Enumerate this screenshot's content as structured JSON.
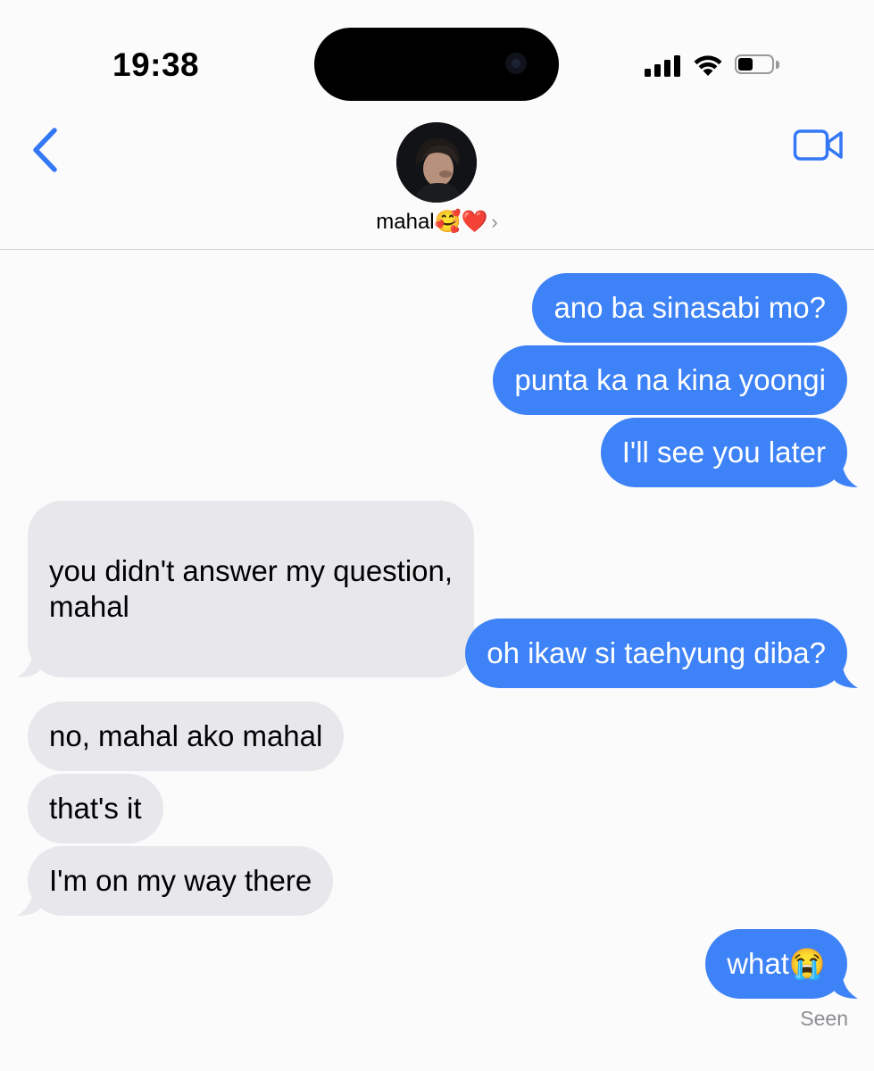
{
  "status_bar": {
    "time": "19:38",
    "battery_level": 0.45
  },
  "header": {
    "contact_name": "mahal🥰❤️",
    "chevron": "›",
    "back_icon": "chevron-left-icon",
    "video_icon": "video-camera-icon"
  },
  "colors": {
    "sent_bubble": "#3e82f7",
    "received_bubble": "#e8e8ec",
    "accent": "#3478f6",
    "background": "#fbfbfb"
  },
  "messages": [
    {
      "side": "sent",
      "text": "ano ba sinasabi mo?"
    },
    {
      "side": "sent",
      "text": "punta ka na kina yoongi"
    },
    {
      "side": "sent",
      "text": "I'll see you later"
    },
    {
      "side": "received",
      "text": "you didn't answer my question,\nmahal"
    },
    {
      "side": "sent",
      "text": "oh ikaw si taehyung diba?"
    },
    {
      "side": "received",
      "text": "no, mahal ako mahal"
    },
    {
      "side": "received",
      "text": "that's it"
    },
    {
      "side": "received",
      "text": "I'm on my way there"
    },
    {
      "side": "sent",
      "text": "what😭"
    }
  ],
  "receipt": "Seen"
}
